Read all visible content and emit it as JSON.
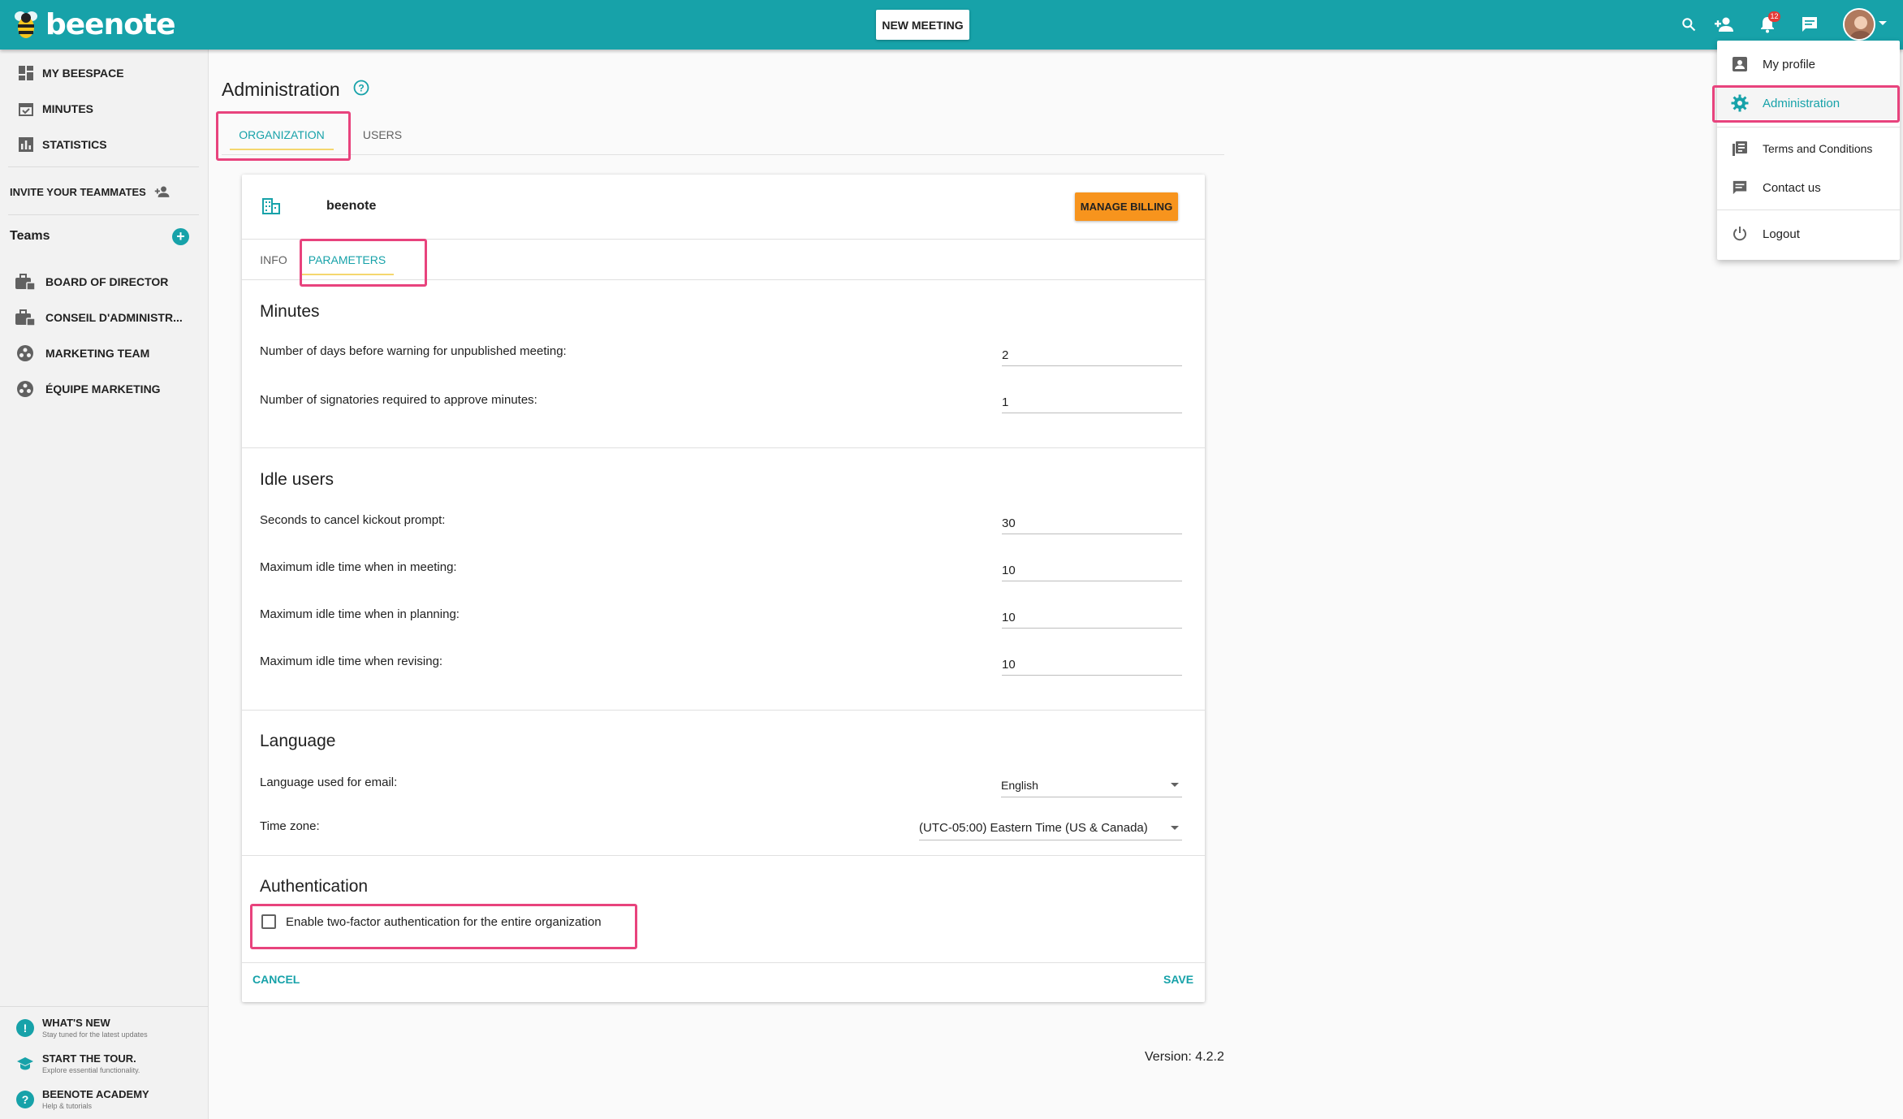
{
  "app": {
    "logo_text": "beenote",
    "new_meeting_label": "NEW MEETING",
    "notification_count": "12"
  },
  "sidebar": {
    "nav": [
      {
        "label": "MY BEESPACE",
        "icon": "dashboard-icon"
      },
      {
        "label": "MINUTES",
        "icon": "calendar-check-icon"
      },
      {
        "label": "STATISTICS",
        "icon": "bar-chart-icon"
      }
    ],
    "invite_label": "INVITE YOUR TEAMMATES",
    "teams_heading": "Teams",
    "teams": [
      {
        "label": "BOARD OF DIRECTOR",
        "icon": "briefcase-lock-icon"
      },
      {
        "label": "CONSEIL D'ADMINISTR...",
        "icon": "briefcase-lock-icon"
      },
      {
        "label": "MARKETING TEAM",
        "icon": "team-icon"
      },
      {
        "label": "ÉQUIPE MARKETING",
        "icon": "team-icon"
      }
    ],
    "footer": [
      {
        "title": "WHAT'S NEW",
        "subtitle": "Stay tuned for the latest updates",
        "icon": "alert-icon"
      },
      {
        "title": "START THE TOUR.",
        "subtitle": "Explore essential functionality.",
        "icon": "school-icon"
      },
      {
        "title": "BEENOTE ACADEMY",
        "subtitle": "Help & tutorials",
        "icon": "help-icon"
      }
    ]
  },
  "page": {
    "title": "Administration",
    "tabs": [
      {
        "label": "ORGANIZATION",
        "active": true
      },
      {
        "label": "USERS",
        "active": false
      }
    ]
  },
  "card": {
    "org_name": "beenote",
    "manage_billing_label": "MANAGE BILLING",
    "tabs": [
      {
        "label": "INFO",
        "active": false
      },
      {
        "label": "PARAMETERS",
        "active": true
      }
    ],
    "minutes": {
      "title": "Minutes",
      "rows": [
        {
          "label": "Number of days before warning for unpublished meeting:",
          "value": "2"
        },
        {
          "label": "Number of signatories required to approve minutes:",
          "value": "1"
        }
      ]
    },
    "idle": {
      "title": "Idle users",
      "rows": [
        {
          "label": "Seconds to cancel kickout prompt:",
          "value": "30"
        },
        {
          "label": "Maximum idle time when in meeting:",
          "value": "10"
        },
        {
          "label": "Maximum idle time when in planning:",
          "value": "10"
        },
        {
          "label": "Maximum idle time when revising:",
          "value": "10"
        }
      ]
    },
    "language": {
      "title": "Language",
      "email_label": "Language used for email:",
      "email_value": "English",
      "timezone_label": "Time zone:",
      "timezone_value": "(UTC-05:00) Eastern Time (US & Canada)"
    },
    "auth": {
      "title": "Authentication",
      "two_factor_label": "Enable two-factor authentication for the entire organization",
      "two_factor_checked": false
    },
    "cancel_label": "CANCEL",
    "save_label": "SAVE"
  },
  "version_text": "Version: 4.2.2",
  "user_menu": {
    "items": [
      {
        "label": "My profile",
        "icon": "account-box-icon",
        "active": false
      },
      {
        "label": "Administration",
        "icon": "gear-icon",
        "active": true
      },
      {
        "label": "Terms and Conditions",
        "icon": "library-books-icon",
        "active": false
      },
      {
        "label": "Contact us",
        "icon": "message-icon",
        "active": false
      },
      {
        "label": "Logout",
        "icon": "power-icon",
        "active": false
      }
    ]
  },
  "colors": {
    "brand": "#17a2a9",
    "highlight": "#e8437d",
    "billing": "#f7941d"
  }
}
